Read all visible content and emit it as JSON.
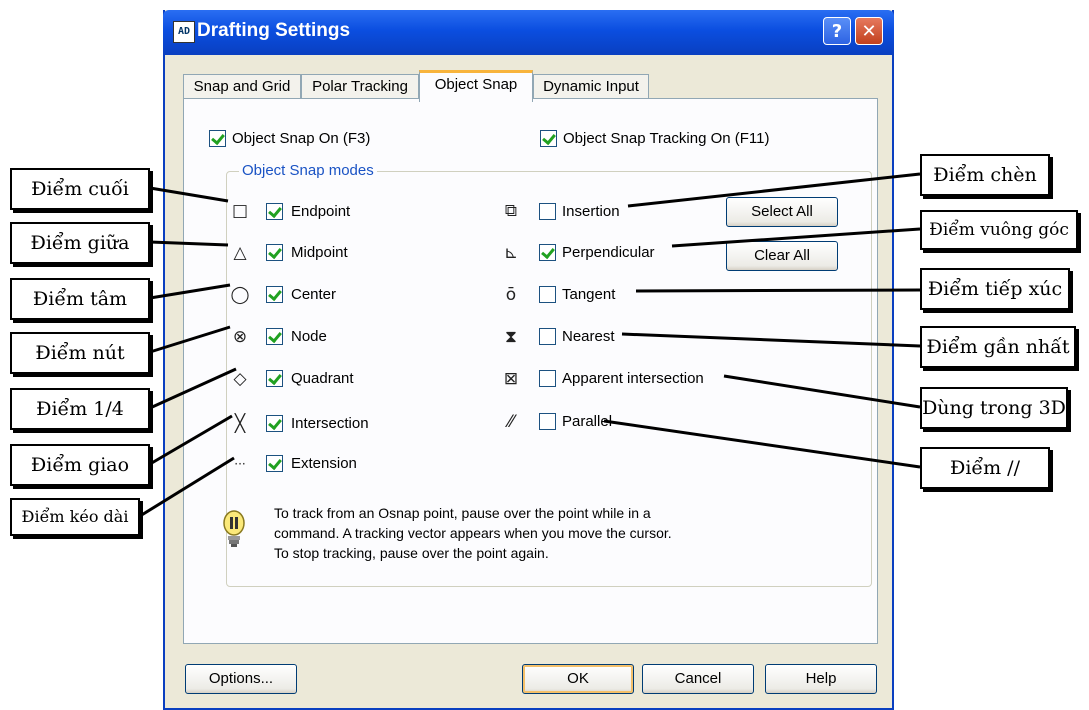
{
  "window": {
    "title": "Drafting Settings",
    "app_icon": "autocad-icon",
    "help_label": "?",
    "close_label": "✕"
  },
  "tabs": [
    {
      "label": "Snap and Grid",
      "active": false
    },
    {
      "label": "Polar Tracking",
      "active": false
    },
    {
      "label": "Object Snap",
      "active": true
    },
    {
      "label": "Dynamic Input",
      "active": false
    }
  ],
  "options": {
    "object_snap_on": {
      "label": "Object Snap On (F3)",
      "checked": true
    },
    "tracking_on": {
      "label": "Object Snap Tracking On (F11)",
      "checked": true
    }
  },
  "modes_group_title": "Object Snap modes",
  "modes_left": [
    {
      "label": "Endpoint",
      "checked": true,
      "icon": "endpoint-icon",
      "glyph": "□"
    },
    {
      "label": "Midpoint",
      "checked": true,
      "icon": "midpoint-icon",
      "glyph": "△"
    },
    {
      "label": "Center",
      "checked": true,
      "icon": "center-icon",
      "glyph": "◯"
    },
    {
      "label": "Node",
      "checked": true,
      "icon": "node-icon",
      "glyph": "⊗"
    },
    {
      "label": "Quadrant",
      "checked": true,
      "icon": "quadrant-icon",
      "glyph": "◇"
    },
    {
      "label": "Intersection",
      "checked": true,
      "icon": "intersection-icon",
      "glyph": "╳"
    },
    {
      "label": "Extension",
      "checked": true,
      "icon": "extension-icon",
      "glyph": "···"
    }
  ],
  "modes_right": [
    {
      "label": "Insertion",
      "checked": false,
      "icon": "insertion-icon",
      "glyph": "⧉"
    },
    {
      "label": "Perpendicular",
      "checked": true,
      "icon": "perpendicular-icon",
      "glyph": "⊾"
    },
    {
      "label": "Tangent",
      "checked": false,
      "icon": "tangent-icon",
      "glyph": "ō"
    },
    {
      "label": "Nearest",
      "checked": false,
      "icon": "nearest-icon",
      "glyph": "⧗"
    },
    {
      "label": "Apparent intersection",
      "checked": false,
      "icon": "apparent-intersection-icon",
      "glyph": "⊠"
    },
    {
      "label": "Parallel",
      "checked": false,
      "icon": "parallel-icon",
      "glyph": "⁄⁄"
    }
  ],
  "buttons": {
    "select_all": "Select All",
    "clear_all": "Clear All",
    "options": "Options...",
    "ok": "OK",
    "cancel": "Cancel",
    "help": "Help"
  },
  "hint": {
    "line1": "To track from an Osnap point, pause over the point while in a",
    "line2": "command.  A tracking vector appears when you move the cursor.",
    "line3": "To stop tracking, pause over the point again."
  },
  "callouts_left": [
    "Điểm cuối",
    "Điểm giữa",
    "Điểm tâm",
    "Điểm nút",
    "Điểm 1/4",
    "Điểm giao",
    "Điểm kéo dài"
  ],
  "callouts_right": [
    "Điểm chèn",
    "Điểm vuông góc",
    "Điểm tiếp xúc",
    "Điểm gần nhất",
    "Dùng trong 3D",
    "Điểm //"
  ],
  "colors": {
    "title_bar": "#0a3fc0",
    "dialog_bg": "#ece9d8",
    "group_title": "#1a53c4",
    "check": "#21a121"
  }
}
